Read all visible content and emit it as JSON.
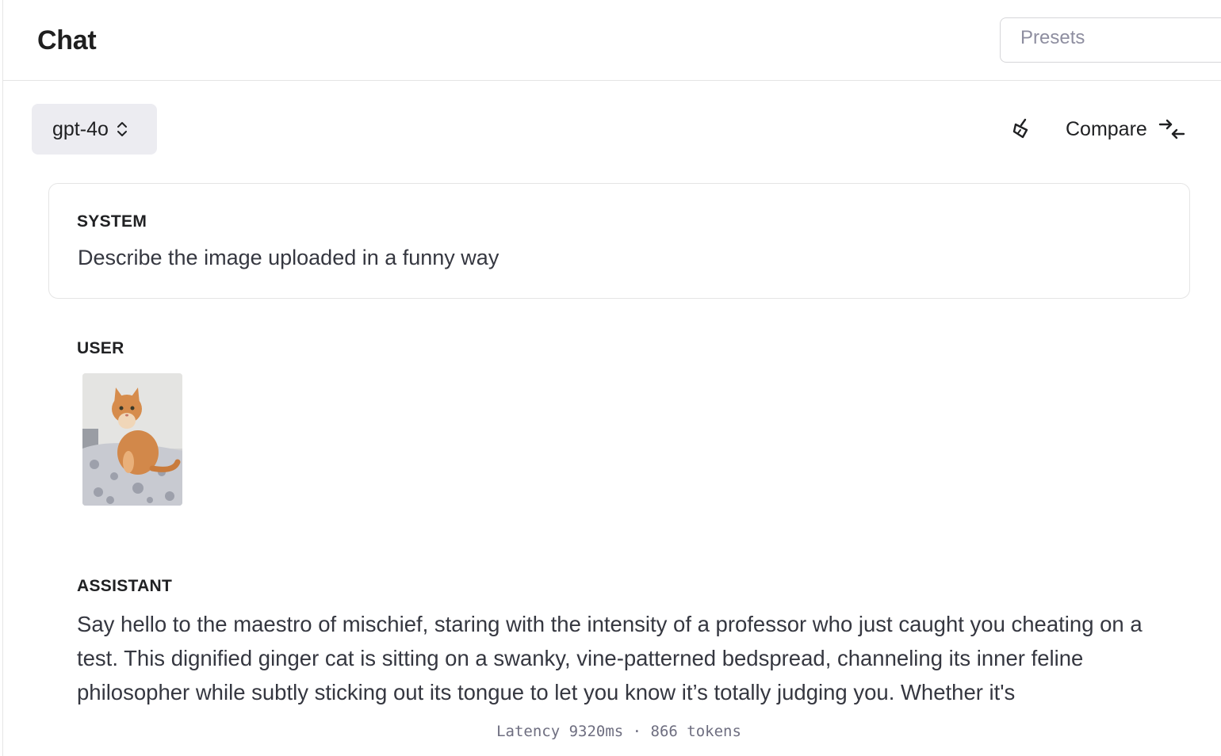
{
  "header": {
    "title": "Chat",
    "presets_placeholder": "Presets"
  },
  "toolbar": {
    "model": "gpt-4o",
    "compare_label": "Compare",
    "clear_icon": "broom-icon",
    "compare_icon": "compare-arrows-icon"
  },
  "messages": {
    "system": {
      "role": "SYSTEM",
      "text": "Describe the image uploaded in a funny way"
    },
    "user": {
      "role": "USER",
      "image_icon": "cat-photo-thumbnail"
    },
    "assistant": {
      "role": "ASSISTANT",
      "text": "Say hello to the maestro of mischief, staring with the intensity of a professor who just caught you cheating on a test. This dignified ginger cat is sitting on a swanky, vine-patterned bedspread, channeling its inner feline philosopher while subtly sticking out its tongue to let you know it’s totally judging you. Whether it's"
    }
  },
  "footer": {
    "latency": "Latency 9320ms · 866 tokens"
  },
  "colors": {
    "accent_bg": "#ececf1",
    "border": "#e5e5e5",
    "text": "#202123",
    "muted": "#6e6e80"
  }
}
